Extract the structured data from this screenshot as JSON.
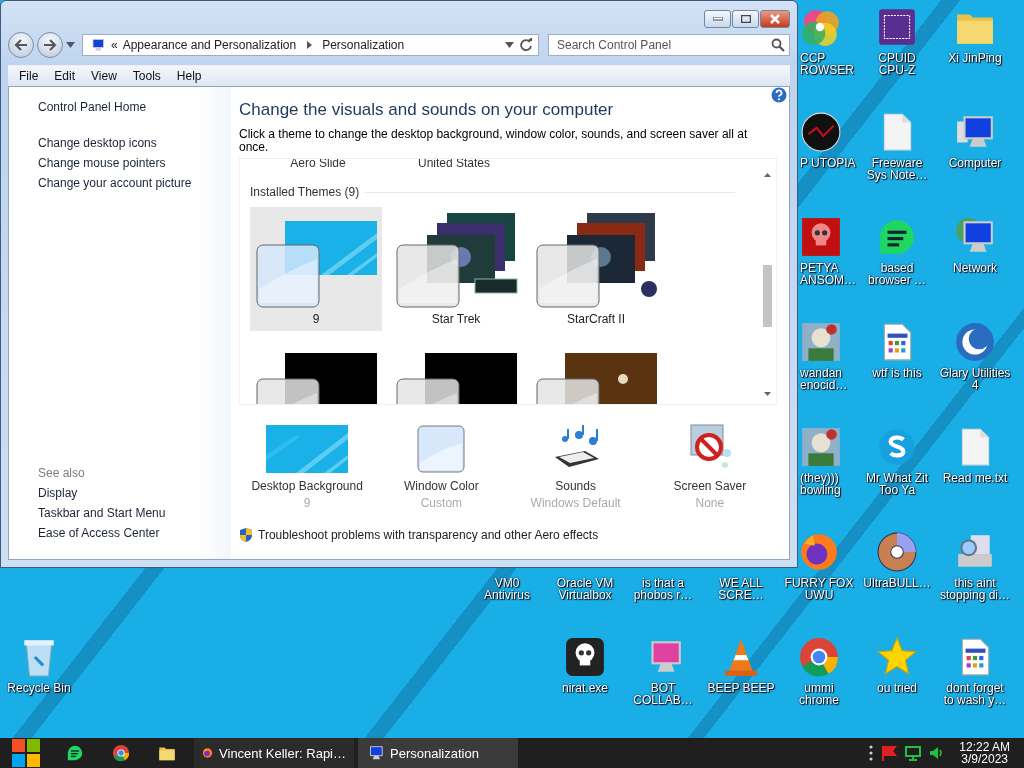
{
  "window": {
    "address": {
      "overflow": "«",
      "crumbs": [
        "Appearance and Personalization",
        "Personalization"
      ]
    },
    "search": {
      "placeholder": "Search Control Panel"
    },
    "menu": [
      "File",
      "Edit",
      "View",
      "Tools",
      "Help"
    ],
    "sidebar": {
      "links": [
        "Control Panel Home",
        "Change desktop icons",
        "Change mouse pointers",
        "Change your account picture"
      ],
      "see_also": {
        "heading": "See also",
        "links": [
          "Display",
          "Taskbar and Start Menu",
          "Ease of Access Center"
        ]
      }
    },
    "main": {
      "heading": "Change the visuals and sounds on your computer",
      "description": "Click a theme to change the desktop background, window color, sounds, and screen saver all at once.",
      "previous_row": [
        "Aero Slide",
        "United States"
      ],
      "group_heading": "Installed Themes (9)",
      "themes": [
        {
          "label": "9",
          "selected": true
        },
        {
          "label": "Star Trek",
          "selected": false
        },
        {
          "label": "StarCraft II",
          "selected": false
        },
        {
          "selected": false
        },
        {
          "selected": false
        },
        {
          "selected": false
        }
      ],
      "settings": [
        {
          "kind": "background",
          "label": "Desktop Background",
          "value": "9"
        },
        {
          "kind": "color",
          "label": "Window Color",
          "value": "Custom"
        },
        {
          "kind": "sounds",
          "label": "Sounds",
          "value": "Windows Default"
        },
        {
          "kind": "screensaver",
          "label": "Screen Saver",
          "value": "None"
        }
      ],
      "troubleshoot": "Troubleshoot problems with transparency and other Aero effects"
    }
  },
  "desktop_icons": [
    {
      "kind": "colorwheel",
      "label": "CCP\nROWSER"
    },
    {
      "kind": "chip",
      "label": "CPUID\nCPU-Z"
    },
    {
      "kind": "folder",
      "label": "Xi JinPing"
    },
    {
      "kind": "dark-circle",
      "label": "P UTOPIA"
    },
    {
      "kind": "document",
      "label": "Freeware\nSys Note…"
    },
    {
      "kind": "computer",
      "label": "Computer"
    },
    {
      "kind": "skull-red",
      "label": "PETYA\nANSOM…"
    },
    {
      "kind": "speech",
      "label": "based\nbrowser …"
    },
    {
      "kind": "network",
      "label": "Network"
    },
    {
      "kind": "picture",
      "label": "wandan\nenocid…"
    },
    {
      "kind": "window-doc",
      "label": "wtf is this"
    },
    {
      "kind": "crescent",
      "label": "Glary Utilities\n4"
    },
    {
      "kind": "picture",
      "label": "(they)))\nbowling"
    },
    {
      "kind": "bubble",
      "label": "Mr What Zit\nToo Ya"
    },
    {
      "kind": "document",
      "label": "Read me.txt"
    },
    {
      "kind": "hidden",
      "label": "VM0\nAntivirus"
    },
    {
      "kind": "hidden",
      "label": "Oracle VM\nVirtualbox"
    },
    {
      "kind": "hidden",
      "label": "is that a\nphobos r…"
    },
    {
      "kind": "hidden",
      "label": "WE ALL\nSCRE…"
    },
    {
      "kind": "fox",
      "label": "FURRY FOX\nUWU"
    },
    {
      "kind": "disc",
      "label": "UltraBULL…"
    },
    {
      "kind": "scanner",
      "label": "this aint\nstopping di…"
    },
    {
      "kind": "bin",
      "label": "Recycle Bin"
    },
    {
      "kind": "skull",
      "label": "nirat.exe"
    },
    {
      "kind": "monitor-pink",
      "label": "BOT\nCOLLAB…"
    },
    {
      "kind": "cone",
      "label": "BEEP BEEP"
    },
    {
      "kind": "chrome",
      "label": "ummi\nchrome"
    },
    {
      "kind": "star",
      "label": "ou tried"
    },
    {
      "kind": "window-doc",
      "label": "dont forget\nto wash y…"
    }
  ],
  "taskbar": {
    "tasks": [
      {
        "kind": "fox",
        "label": "Vincent Keller: Rapi…",
        "selected": false
      },
      {
        "kind": "monitor",
        "label": "Personalization",
        "selected": true
      }
    ],
    "clock": {
      "time": "12:22 AM",
      "date": "3/9/2023"
    }
  }
}
